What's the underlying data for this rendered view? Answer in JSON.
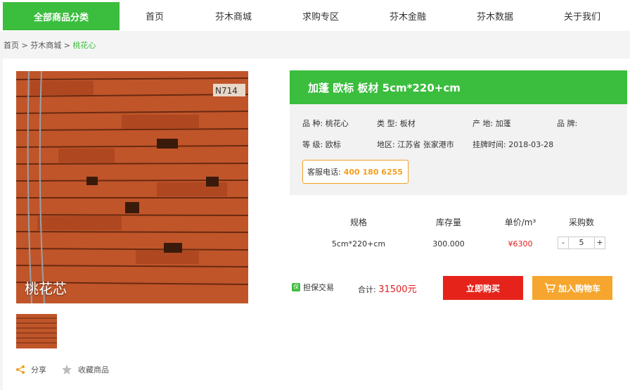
{
  "nav": {
    "category": "全部商品分类",
    "items": [
      "首页",
      "芬木商城",
      "求购专区",
      "芬木金融",
      "芬木数据",
      "关于我们"
    ]
  },
  "breadcrumb": {
    "home": "首页",
    "sep1": " > ",
    "mall": "芬木商城",
    "sep2": " > ",
    "current": "桃花心"
  },
  "product": {
    "title": "加蓬 欧标 板材 5cm*220+cm",
    "image_label": "桃花芯",
    "attributes": {
      "variety": "品  种:  桃花心",
      "type": "类  型:  板材",
      "origin": "产      地:  加蓬",
      "brand": "品  牌:",
      "grade": "等  级:   欧标",
      "region": "地区:  江苏省 张家港市",
      "listed": "挂牌时间:   2018-03-28"
    },
    "service_phone_label": "客服电话:",
    "service_phone": "400 180 6255"
  },
  "table": {
    "headers": [
      "规格",
      "库存量",
      "单价/m³",
      "采购数"
    ],
    "row": {
      "spec": "5cm*220+cm",
      "stock": "300.000",
      "price": "¥6300",
      "qty": "5"
    },
    "minus": "-",
    "plus": "+"
  },
  "actions": {
    "guarantee": "担保交易",
    "total_label": "合计:",
    "total_value": "31500元",
    "buy_now": "立即购买",
    "add_cart": "加入购物车"
  },
  "social": {
    "share": "分享",
    "favorite": "收藏商品"
  },
  "colors": {
    "green": "#3bbd3d",
    "red": "#e6231b",
    "orange": "#f6a62e"
  }
}
